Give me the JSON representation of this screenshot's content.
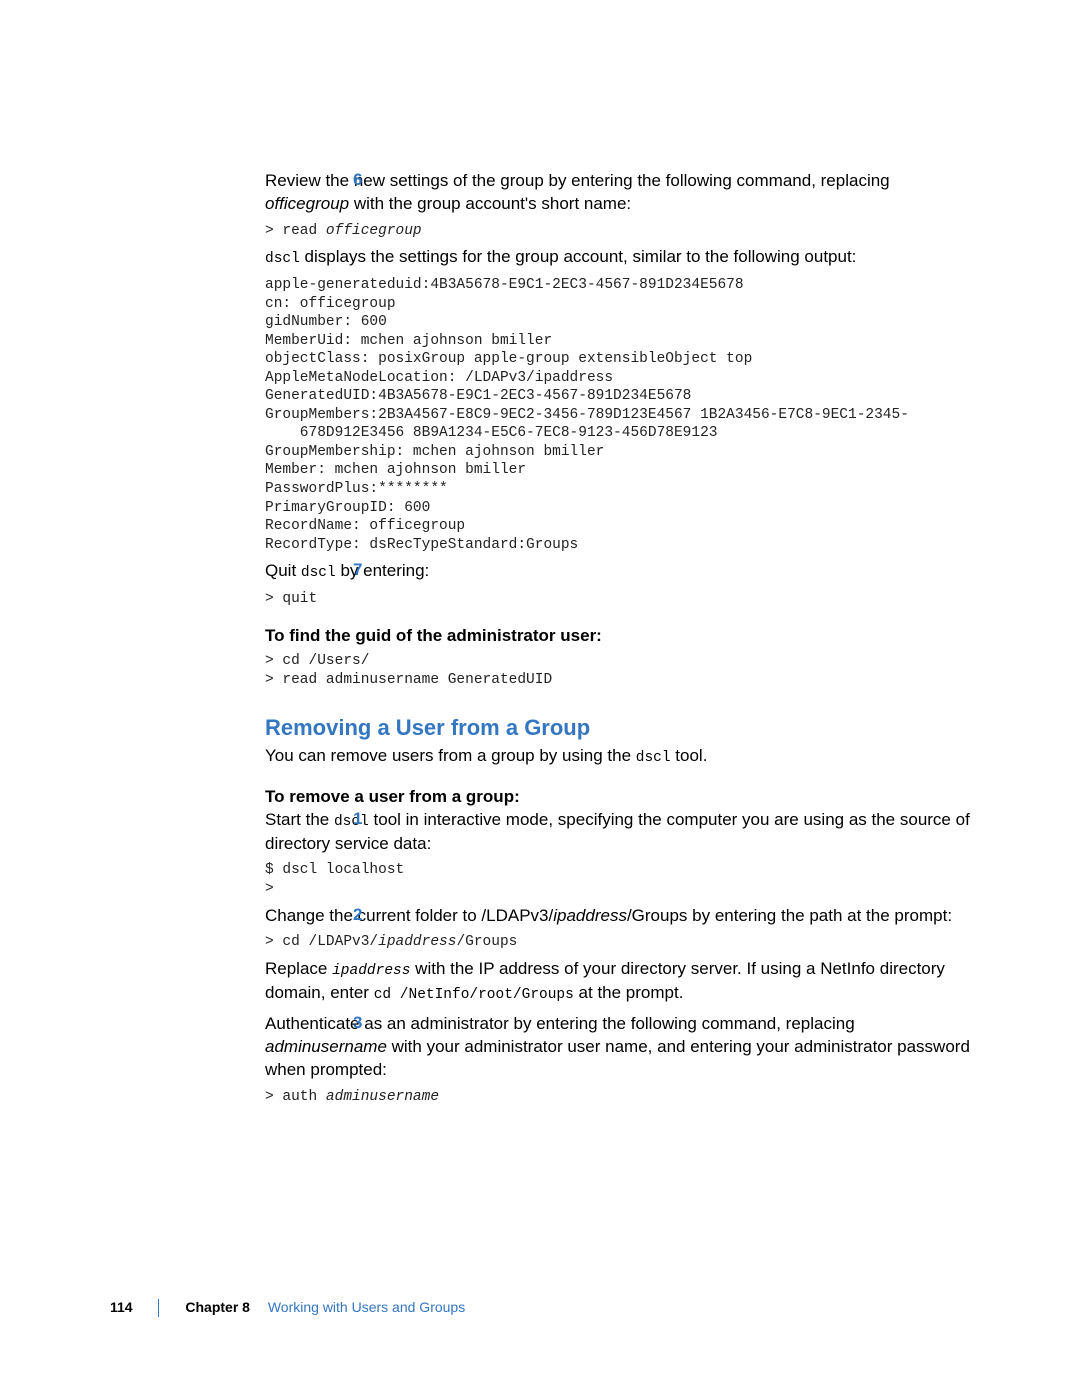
{
  "step6": {
    "num": "6",
    "line1_a": "Review the new settings of the group by entering the following command, replacing ",
    "line1_em": "officegroup",
    "line1_b": " with the group account's short name:",
    "code1_a": "> read ",
    "code1_em": "officegroup",
    "line2_a": "dscl",
    "line2_b": " displays the settings for the group account, similar to the following output:",
    "output": "apple-generateduid:4B3A5678-E9C1-2EC3-4567-891D234E5678\ncn: officegroup\ngidNumber: 600\nMemberUid: mchen ajohnson bmiller\nobjectClass: posixGroup apple-group extensibleObject top\nAppleMetaNodeLocation: /LDAPv3/ipaddress\nGeneratedUID:4B3A5678-E9C1-2EC3-4567-891D234E5678\nGroupMembers:2B3A4567-E8C9-9EC2-3456-789D123E4567 1B2A3456-E7C8-9EC1-2345-\n    678D912E3456 8B9A1234-E5C6-7EC8-9123-456D78E9123\nGroupMembership: mchen ajohnson bmiller\nMember: mchen ajohnson bmiller\nPasswordPlus:********\nPrimaryGroupID: 600\nRecordName: officegroup\nRecordType: dsRecTypeStandard:Groups"
  },
  "step7": {
    "num": "7",
    "line1_a": "Quit ",
    "line1_code": "dscl",
    "line1_b": " by entering:",
    "code": "> quit"
  },
  "guid": {
    "head": "To find the guid of the administrator user:",
    "code": "> cd /Users/\n> read adminusername GeneratedUID"
  },
  "remove": {
    "heading": "Removing a User from a Group",
    "intro_a": "You can remove users from a group by using the ",
    "intro_code": "dscl",
    "intro_b": " tool.",
    "subhead": "To remove a user from a group:"
  },
  "r1": {
    "num": "1",
    "line_a": "Start the ",
    "line_code": "dscl",
    "line_b": " tool in interactive mode, specifying the computer you are using as the source of directory service data:",
    "code": "$ dscl localhost\n>"
  },
  "r2": {
    "num": "2",
    "line_a": "Change the current folder to /LDAPv3/",
    "line_em": "ipaddress",
    "line_b": "/Groups by entering the path at the prompt:",
    "code_a": "> cd /LDAPv3/",
    "code_em": "ipaddress",
    "code_b": "/Groups",
    "after_a": "Replace ",
    "after_codeem": "ipaddress",
    "after_b": " with the IP address of your directory server. If using a NetInfo directory domain, enter ",
    "after_code2": "cd /NetInfo/root/Groups",
    "after_c": " at the prompt."
  },
  "r3": {
    "num": "3",
    "line_a": "Authenticate as an administrator by entering the following command, replacing ",
    "line_em": "adminusername",
    "line_b": " with your administrator user name, and entering your administrator password when prompted:",
    "code_a": "> auth ",
    "code_em": "adminusername"
  },
  "footer": {
    "page": "114",
    "chapter": "Chapter 8",
    "title": "Working with Users and Groups"
  }
}
